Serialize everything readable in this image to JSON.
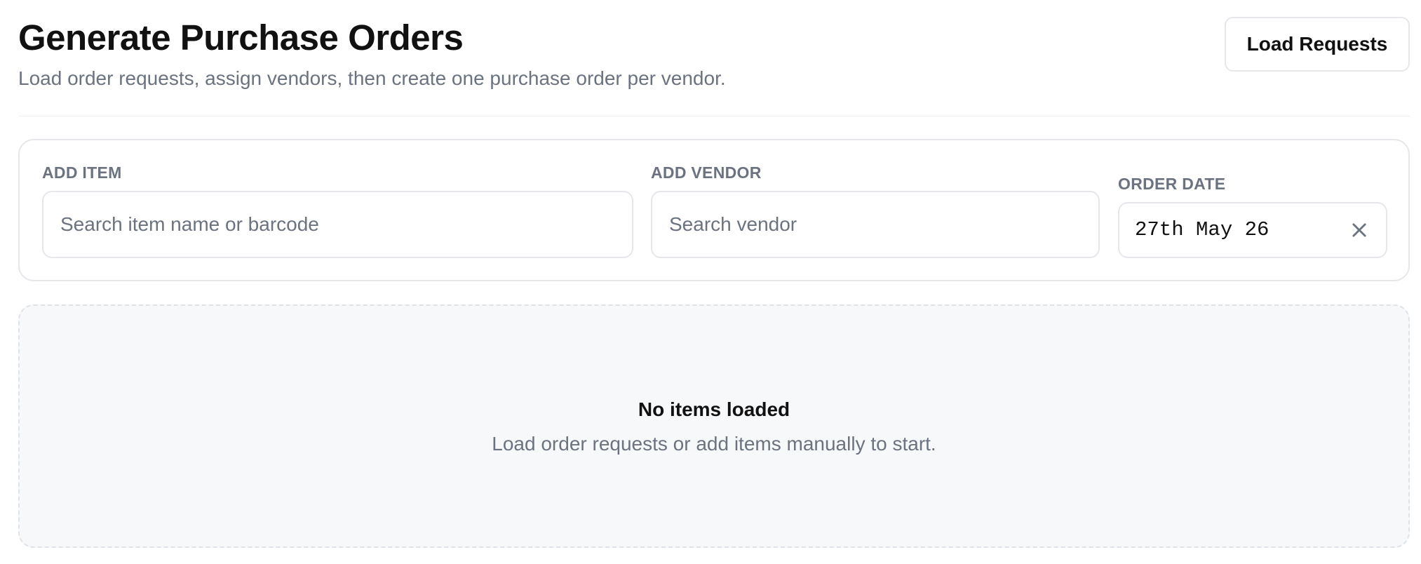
{
  "header": {
    "title": "Generate Purchase Orders",
    "subtitle": "Load order requests, assign vendors, then create one purchase order per vendor.",
    "load_button_label": "Load Requests"
  },
  "form": {
    "item": {
      "label": "ADD ITEM",
      "placeholder": "Search item name or barcode",
      "value": ""
    },
    "vendor": {
      "label": "ADD VENDOR",
      "placeholder": "Search vendor",
      "value": ""
    },
    "order_date": {
      "label": "ORDER DATE",
      "value": "27th May 26",
      "clear_icon": "close-icon"
    }
  },
  "empty_state": {
    "title": "No items loaded",
    "description": "Load order requests or add items manually to start."
  },
  "colors": {
    "text_primary": "#111111",
    "text_muted": "#6b7280",
    "border": "#e5e7eb",
    "empty_bg": "#f7f8fa"
  }
}
